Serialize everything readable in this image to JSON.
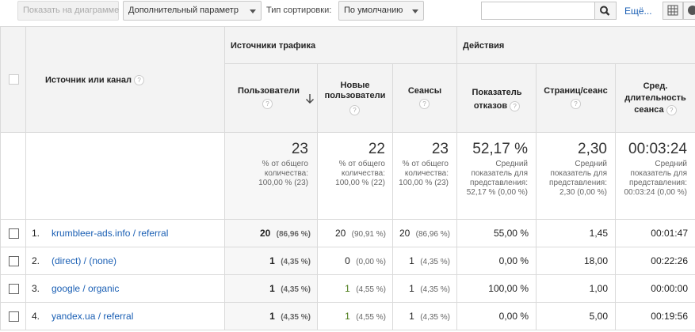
{
  "toolbar": {
    "show_chart": "Показать на диаграмме",
    "secondary": "Дополнительный параметр",
    "sort_label": "Тип сортировки:",
    "sort_value": "По умолчанию",
    "search_value": "",
    "more": "Ещё..."
  },
  "headers": {
    "source": "Источник или канал",
    "group_traffic": "Источники трафика",
    "group_actions": "Действия",
    "users": "Пользователи",
    "new_users": "Новые пользователи",
    "sessions": "Сеансы",
    "bounce": "Показатель отказов",
    "pages": "Страниц/сеанс",
    "duration": "Сред. длительность сеанса",
    "help": "?"
  },
  "totals": {
    "users": {
      "value": "23",
      "note": "% от общего количества: 100,00 % (23)"
    },
    "new_users": {
      "value": "22",
      "note": "% от общего количества: 100,00 % (22)"
    },
    "sessions": {
      "value": "23",
      "note": "% от общего количества: 100,00 % (23)"
    },
    "bounce": {
      "value": "52,17 %",
      "note": "Средний показатель для представления: 52,17 % (0,00 %)"
    },
    "pages": {
      "value": "2,30",
      "note": "Средний показатель для представления: 2,30 (0,00 %)"
    },
    "duration": {
      "value": "00:03:24",
      "note": "Средний показатель для представления: 00:03:24 (0,00 %)"
    }
  },
  "rows": [
    {
      "n": "1.",
      "source": "krumbleer-ads.info / referral",
      "users": "20",
      "users_pct": "(86,96 %)",
      "new": "20",
      "new_pct": "(90,91 %)",
      "sessions": "20",
      "sessions_pct": "(86,96 %)",
      "bounce": "55,00 %",
      "pages": "1,45",
      "duration": "00:01:47"
    },
    {
      "n": "2.",
      "source": "(direct) / (none)",
      "users": "1",
      "users_pct": "(4,35 %)",
      "new": "0",
      "new_pct": "(0,00 %)",
      "sessions": "1",
      "sessions_pct": "(4,35 %)",
      "bounce": "0,00 %",
      "pages": "18,00",
      "duration": "00:22:26"
    },
    {
      "n": "3.",
      "source": "google / organic",
      "users": "1",
      "users_pct": "(4,35 %)",
      "new": "1",
      "new_pct": "(4,55 %)",
      "sessions": "1",
      "sessions_pct": "(4,35 %)",
      "bounce": "100,00 %",
      "pages": "1,00",
      "duration": "00:00:00"
    },
    {
      "n": "4.",
      "source": "yandex.ua / referral",
      "users": "1",
      "users_pct": "(4,35 %)",
      "new": "1",
      "new_pct": "(4,55 %)",
      "sessions": "1",
      "sessions_pct": "(4,35 %)",
      "bounce": "0,00 %",
      "pages": "5,00",
      "duration": "00:19:56"
    }
  ]
}
